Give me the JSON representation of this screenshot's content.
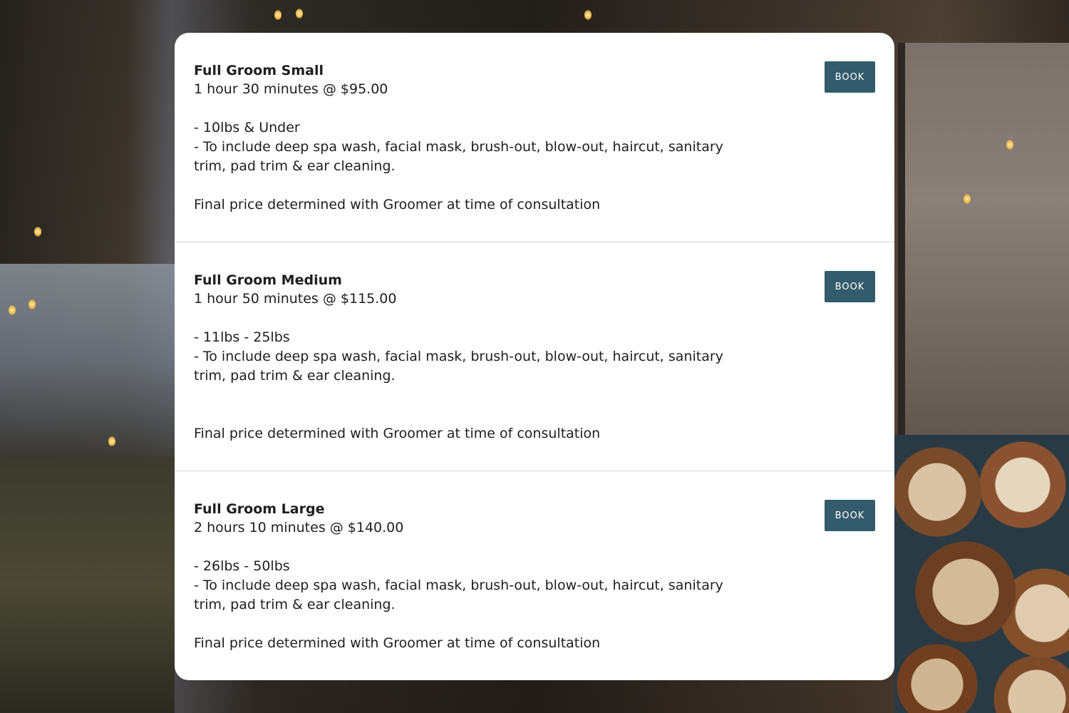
{
  "services": [
    {
      "name": "Full Groom Small",
      "duration_price": "1 hour 30 minutes @ $95.00",
      "size_line": "- 10lbs & Under",
      "includes_line": "- To include deep spa wash, facial mask, brush-out, blow-out, haircut, sanitary trim, pad trim & ear cleaning.",
      "note": "Final price determined with Groomer at time of consultation",
      "button_label": "BOOK"
    },
    {
      "name": "Full Groom Medium",
      "duration_price": "1 hour 50 minutes @ $115.00",
      "size_line": "- 11lbs - 25lbs",
      "includes_line": "- To include deep spa wash, facial mask, brush-out, blow-out, haircut, sanitary trim, pad trim & ear cleaning.",
      "note": "Final price determined with Groomer at time of consultation",
      "button_label": "BOOK"
    },
    {
      "name": "Full Groom Large",
      "duration_price": "2 hours 10 minutes @ $140.00",
      "size_line": "- 26lbs - 50lbs",
      "includes_line": "- To include deep spa wash, facial mask, brush-out, blow-out, haircut, sanitary trim, pad trim & ear cleaning.",
      "note": "Final price determined with Groomer at time of consultation",
      "button_label": "BOOK"
    }
  ],
  "colors": {
    "button_bg": "#335b6b",
    "text": "#1e1e1e",
    "divider": "#d6d6d6"
  }
}
